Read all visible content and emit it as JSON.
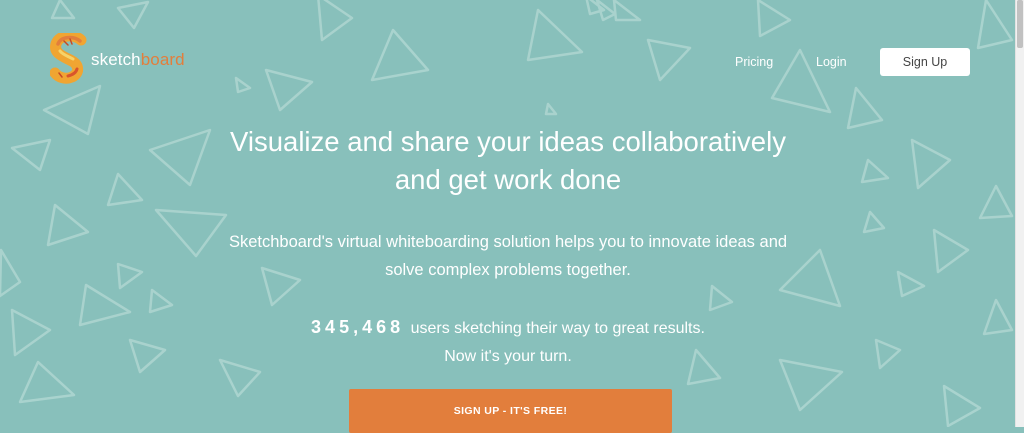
{
  "brand": {
    "name_part1": "sketch",
    "name_part2": "board",
    "accent_color": "#e27e3c",
    "background_color": "#88c0bb"
  },
  "nav": {
    "pricing_label": "Pricing",
    "login_label": "Login",
    "signup_label": "Sign Up"
  },
  "hero": {
    "title_line1": "Visualize and share your ideas collaboratively",
    "title_line2": "and get work done",
    "subtitle_line1": "Sketchboard's virtual whiteboarding solution helps you to innovate ideas and",
    "subtitle_line2": "solve complex problems together.",
    "user_count": "345,468",
    "stats_line1_rest": "users sketching their way to great results.",
    "stats_line2": "Now it's your turn.",
    "cta_label": "SIGN UP - IT'S FREE!"
  }
}
